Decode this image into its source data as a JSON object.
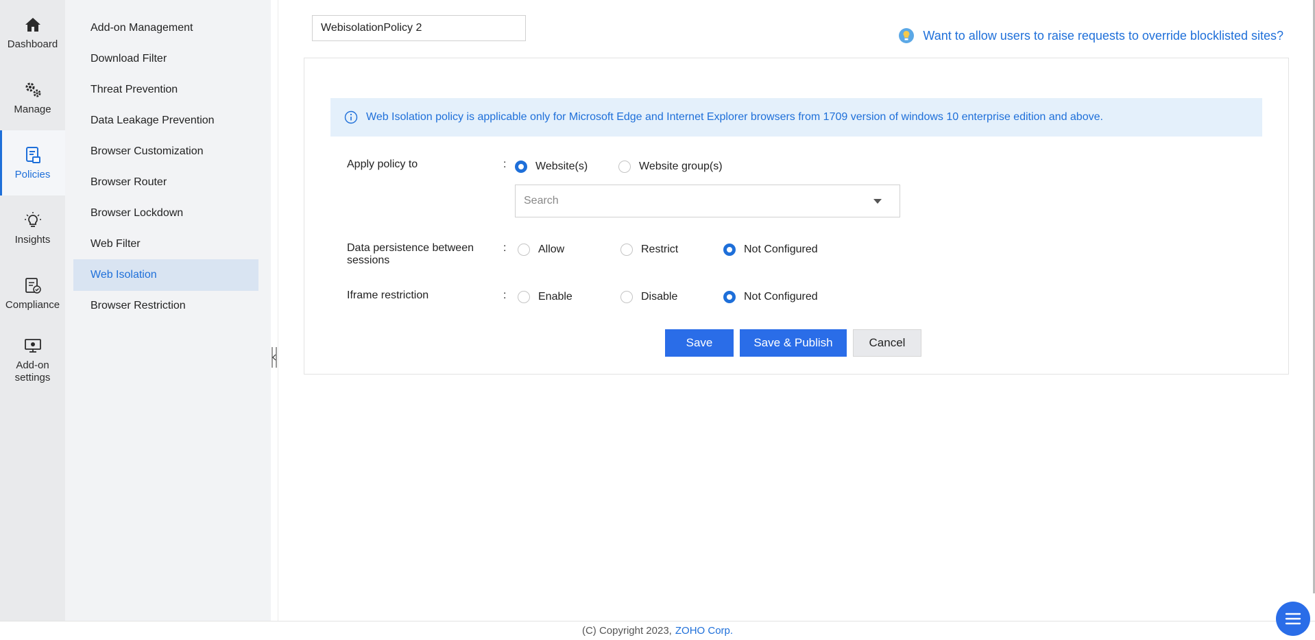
{
  "rail": {
    "items": [
      {
        "label": "Dashboard",
        "icon": "home-icon"
      },
      {
        "label": "Manage",
        "icon": "gears-icon"
      },
      {
        "label": "Policies",
        "icon": "policy-icon"
      },
      {
        "label": "Insights",
        "icon": "bulb-icon"
      },
      {
        "label": "Compliance",
        "icon": "checklist-icon"
      },
      {
        "label": "Add-on settings",
        "icon": "monitor-settings-icon"
      }
    ],
    "active": "Policies"
  },
  "subnav": {
    "items": [
      "Add-on Management",
      "Download Filter",
      "Threat Prevention",
      "Data Leakage Prevention",
      "Browser Customization",
      "Browser Router",
      "Browser Lockdown",
      "Web Filter",
      "Web Isolation",
      "Browser Restriction"
    ],
    "active": "Web Isolation"
  },
  "policy": {
    "name": "WebisolationPolicy 2",
    "help_link": "Want to allow users to raise requests to override blocklisted sites?",
    "info": "Web Isolation policy is applicable only for Microsoft Edge and Internet Explorer browsers from 1709 version of windows 10 enterprise edition and above.",
    "apply_label": "Apply policy to",
    "colon": ":",
    "apply_options": [
      "Website(s)",
      "Website group(s)"
    ],
    "apply_selected": "Website(s)",
    "search_placeholder": "Search",
    "persistence_label_line1": "Data persistence between",
    "persistence_label_line2": "sessions",
    "persistence_options": [
      "Allow",
      "Restrict",
      "Not Configured"
    ],
    "persistence_selected": "Not Configured",
    "iframe_label": "Iframe restriction",
    "iframe_options": [
      "Enable",
      "Disable",
      "Not Configured"
    ],
    "iframe_selected": "Not Configured"
  },
  "buttons": {
    "save": "Save",
    "save_publish": "Save & Publish",
    "cancel": "Cancel"
  },
  "footer": {
    "copyright": "(C) Copyright 2023,",
    "company": "ZOHO Corp."
  },
  "colors": {
    "accent": "#1e6fd9",
    "button": "#2a6de8",
    "info_bg": "#e4f0fb"
  }
}
